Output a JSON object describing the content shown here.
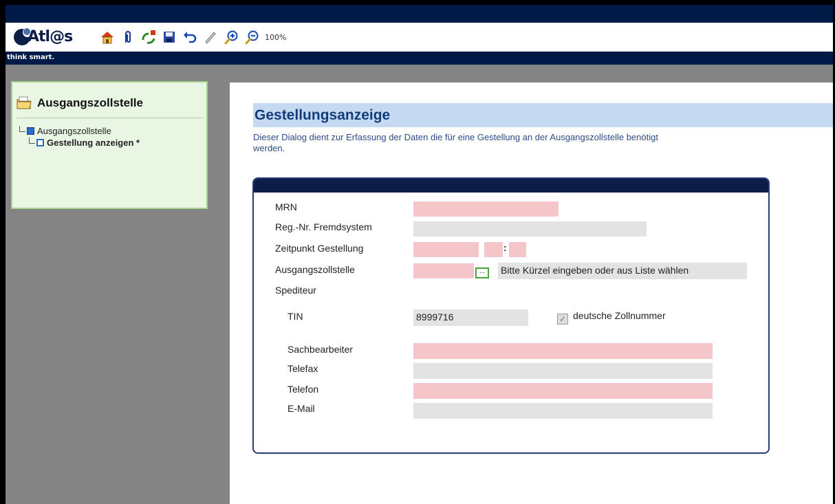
{
  "app": {
    "logo_text": "Atl@s",
    "tagline": "think smart.",
    "zoom": "100%"
  },
  "toolbar": {
    "icons": [
      "home-icon",
      "attach-icon",
      "recycle-icon",
      "save-icon",
      "undo-icon",
      "pencil-icon",
      "zoom-in-icon",
      "zoom-out-icon"
    ]
  },
  "sidebar": {
    "title": "Ausgangszollstelle",
    "tree": [
      {
        "label": "Ausgangszollstelle"
      },
      {
        "label": "Gestellung anzeigen *"
      }
    ]
  },
  "main": {
    "title": "Gestellungsanzeige",
    "description": "Dieser Dialog dient zur Erfassung der Daten die für eine Gestellung an der Ausgangszollstelle benötigt werden."
  },
  "form": {
    "mrn_label": "MRN",
    "regnr_label": "Reg.-Nr. Fremdsystem",
    "zeitpunkt_label": "Zeitpunkt Gestellung",
    "time_separator": ":",
    "ausgangszollstelle_label": "Ausgangszollstelle",
    "picker_label": "...",
    "ausgangszollstelle_hint": "Bitte Kürzel eingeben oder aus Liste wählen",
    "spediteur_label": "Spediteur",
    "tin_label": "TIN",
    "tin_value": "8999716",
    "deutsche_zollnummer_label": "deutsche Zollnummer",
    "deutsche_zollnummer_checked": true,
    "sachbearbeiter_label": "Sachbearbeiter",
    "telefax_label": "Telefax",
    "telefon_label": "Telefon",
    "email_label": "E-Mail"
  },
  "colors": {
    "navy": "#001a48",
    "required_field": "#f5c6c9",
    "optional_field": "#e3e3e3",
    "heading_bg": "#c5daf2",
    "heading_text": "#123c7a",
    "panel_bg": "#eaf6e4"
  }
}
